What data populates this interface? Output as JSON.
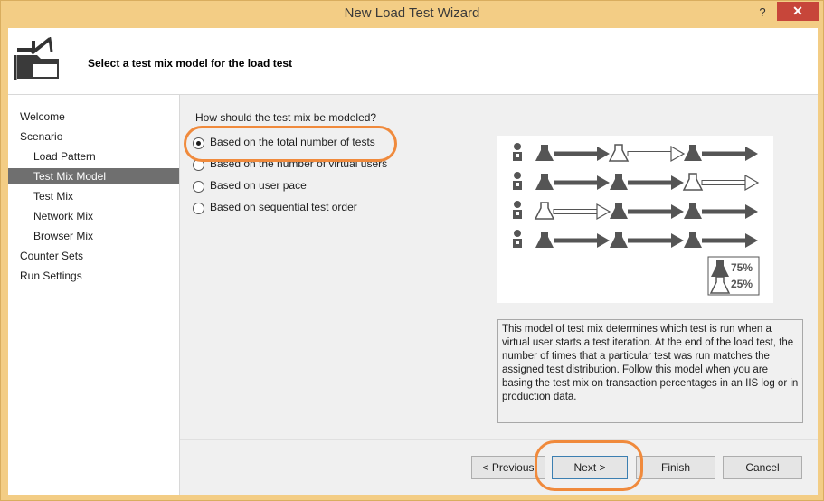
{
  "window": {
    "title": "New Load Test Wizard",
    "help_glyph": "?",
    "close_glyph": "✕"
  },
  "header": {
    "text": "Select a test mix model for the load test"
  },
  "nav": {
    "items": [
      {
        "label": "Welcome"
      },
      {
        "label": "Scenario"
      },
      {
        "label": "Load Pattern"
      },
      {
        "label": "Test Mix Model"
      },
      {
        "label": "Test Mix"
      },
      {
        "label": "Network Mix"
      },
      {
        "label": "Browser Mix"
      },
      {
        "label": "Counter Sets"
      },
      {
        "label": "Run Settings"
      }
    ],
    "selected": "Test Mix Model"
  },
  "main": {
    "question": "How should the test mix be modeled?",
    "options": [
      {
        "label": "Based on the total number of tests",
        "checked": true
      },
      {
        "label": "Based on the number of virtual users",
        "checked": false
      },
      {
        "label": "Based on user pace",
        "checked": false
      },
      {
        "label": "Based on sequential test order",
        "checked": false
      }
    ],
    "illustration": {
      "legend_filled": "75%",
      "legend_outline": "25%"
    },
    "description": "This model of test mix determines which test is run when a virtual user starts a test iteration. At the end of the load test, the number of times that a particular test was run matches the assigned test distribution. Follow this model when you are basing the test mix on transaction percentages in an IIS log or in production data."
  },
  "buttons": {
    "previous": "< Previous",
    "next": "Next >",
    "finish": "Finish",
    "cancel": "Cancel"
  },
  "colors": {
    "highlight": "#f08a3c",
    "selected_nav": "#6f6f6f",
    "close": "#c7463a"
  }
}
